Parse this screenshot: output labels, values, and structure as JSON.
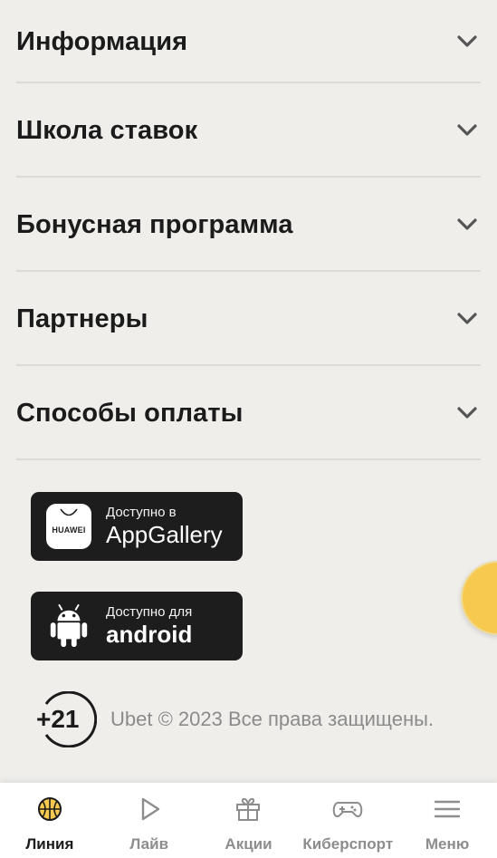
{
  "accordion": {
    "items": [
      {
        "label": "Информация"
      },
      {
        "label": "Школа ставок"
      },
      {
        "label": "Бонусная программа"
      },
      {
        "label": "Партнеры"
      },
      {
        "label": "Способы оплаты"
      }
    ]
  },
  "stores": {
    "huawei": {
      "small": "Доступно в",
      "big": "AppGallery",
      "logo_text": "HUAWEI",
      "icon": "huawei-appgallery-icon"
    },
    "android": {
      "small": "Доступно для",
      "big": "android",
      "icon": "android-icon"
    }
  },
  "footer": {
    "age_rating": "+21",
    "copyright": "Ubet © 2023 Все права защищены."
  },
  "bottom_nav": {
    "items": [
      {
        "label": "Линия",
        "icon": "basketball-icon",
        "active": true
      },
      {
        "label": "Лайв",
        "icon": "play-icon",
        "active": false
      },
      {
        "label": "Акции",
        "icon": "gift-icon",
        "active": false
      },
      {
        "label": "Киберспорт",
        "icon": "gamepad-icon",
        "active": false
      },
      {
        "label": "Меню",
        "icon": "menu-icon",
        "active": false
      }
    ]
  },
  "colors": {
    "background": "#efeeeb",
    "accent": "#f7c94e",
    "store_button": "#1d1d1d",
    "nav_active": "#1b1b1b",
    "nav_inactive": "#8d8d8d"
  }
}
